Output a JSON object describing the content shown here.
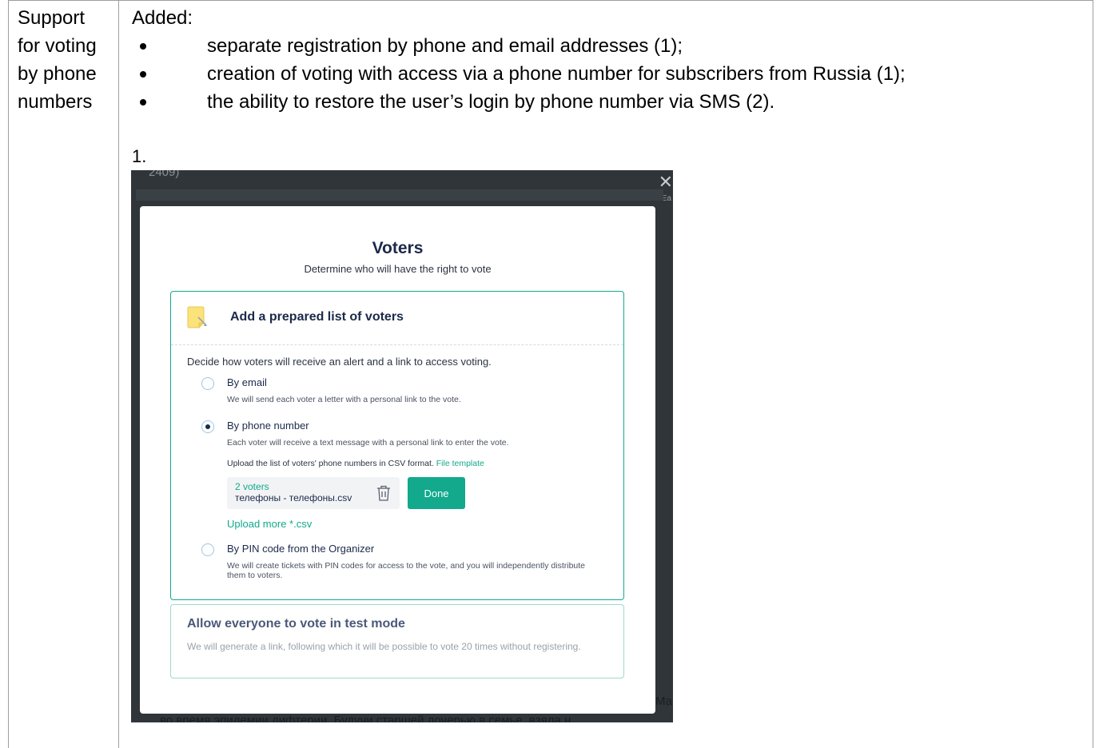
{
  "table": {
    "left_cell": [
      "Support",
      "for voting",
      "by phone",
      "numbers"
    ],
    "added_label": "Added:",
    "bullets": [
      "separate registration by phone and email addresses (1);",
      "creation of voting with access via a phone number for subscribers from Russia (1);",
      "the ability to restore the user’s login by phone number via SMS (2)."
    ],
    "figure_number": "1."
  },
  "screenshot": {
    "background_text": {
      "top": "2409)",
      "bottom": "во время эпидемии дифтерии. Будучи старшей дочерью в семье, взяла н",
      "right_fragment": "Мар",
      "corner": "Ea"
    },
    "modal": {
      "title": "Voters",
      "subtitle": "Determine who will have the right to vote",
      "prepared_list": {
        "title": "Add a prepared list of voters",
        "instruction": "Decide how voters will receive an alert and a link to access voting.",
        "options": [
          {
            "label": "By email",
            "description": "We will send each voter a letter with a personal link to the vote.",
            "selected": false
          },
          {
            "label": "By phone number",
            "description": "Each voter will receive a text message with a personal link to enter the vote.",
            "selected": true
          },
          {
            "label": "By PIN code from the Organizer",
            "description": "We will create tickets with PIN codes for access to the vote, and you will independently distribute them to voters.",
            "selected": false
          }
        ],
        "upload_text": "Upload the list of voters' phone numbers in CSV format.",
        "file_template_link": "File template",
        "file": {
          "count": "2 voters",
          "name": "телефоны - телефоны.csv"
        },
        "done_button": "Done",
        "upload_more": "Upload more *.csv"
      },
      "test_mode": {
        "title": "Allow everyone to vote in test mode",
        "description": "We will generate a link, following which it will be possible to vote 20 times without registering."
      }
    },
    "colors": {
      "accent": "#12a98c",
      "heading": "#1b2a4a",
      "overlay": "#2f3539"
    }
  }
}
